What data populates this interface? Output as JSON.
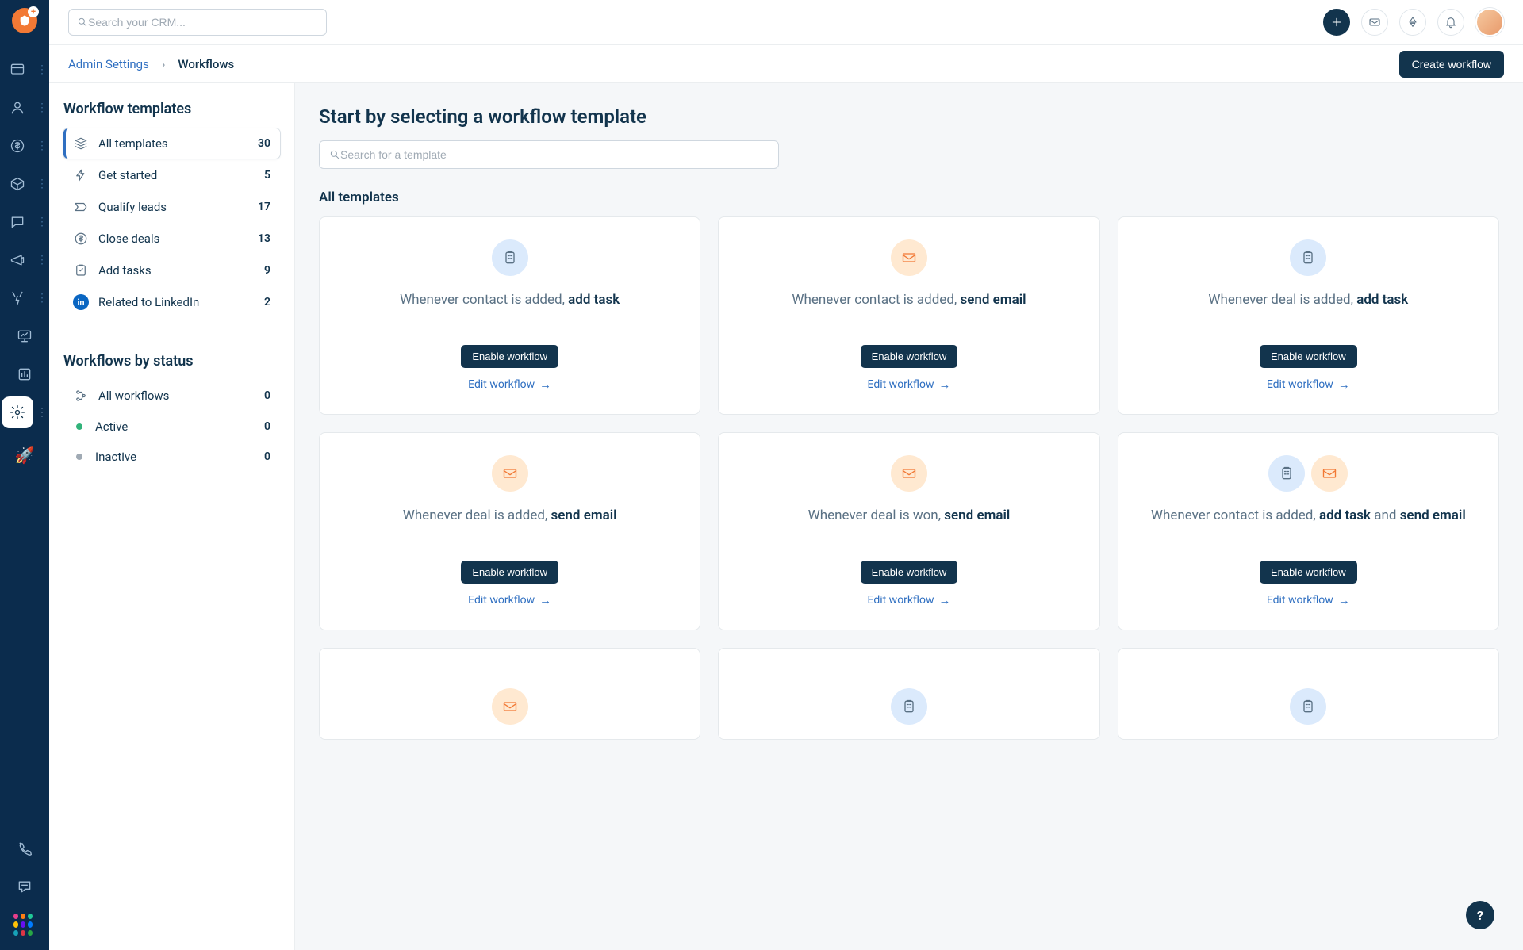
{
  "search_placeholder": "Search your CRM...",
  "breadcrumb": {
    "parent": "Admin Settings",
    "current": "Workflows"
  },
  "create_button": "Create workflow",
  "sidebar": {
    "templates_header": "Workflow templates",
    "status_header": "Workflows by status",
    "templates": [
      {
        "id": "all",
        "label": "All templates",
        "count": 30,
        "active": true
      },
      {
        "id": "get-started",
        "label": "Get started",
        "count": 5
      },
      {
        "id": "qualify-leads",
        "label": "Qualify leads",
        "count": 17
      },
      {
        "id": "close-deals",
        "label": "Close deals",
        "count": 13
      },
      {
        "id": "add-tasks",
        "label": "Add tasks",
        "count": 9
      },
      {
        "id": "linkedin",
        "label": "Related to LinkedIn",
        "count": 2
      }
    ],
    "status": [
      {
        "id": "all-wf",
        "label": "All workflows",
        "count": 0
      },
      {
        "id": "active",
        "label": "Active",
        "count": 0,
        "dot": "green"
      },
      {
        "id": "inactive",
        "label": "Inactive",
        "count": 0,
        "dot": "gray"
      }
    ]
  },
  "panel": {
    "heading": "Start by selecting a workflow template",
    "search_placeholder": "Search for a template",
    "section_title": "All templates",
    "enable_label": "Enable workflow",
    "edit_label": "Edit workflow",
    "cards": [
      {
        "icons": [
          "task"
        ],
        "prefix": "Whenever contact is added, ",
        "bold": "add task",
        "suffix": ""
      },
      {
        "icons": [
          "email"
        ],
        "prefix": "Whenever contact is added, ",
        "bold": "send email",
        "suffix": ""
      },
      {
        "icons": [
          "task"
        ],
        "prefix": "Whenever deal is added, ",
        "bold": "add task",
        "suffix": ""
      },
      {
        "icons": [
          "email"
        ],
        "prefix": "Whenever deal is added, ",
        "bold": "send email",
        "suffix": ""
      },
      {
        "icons": [
          "email"
        ],
        "prefix": "Whenever deal is won, ",
        "bold": "send email",
        "suffix": ""
      },
      {
        "icons": [
          "task",
          "email"
        ],
        "prefix": "Whenever contact is added, ",
        "bold": "add task",
        "mid": " and ",
        "bold2": "send email"
      }
    ],
    "placeholder_row": [
      {
        "icons": [
          "email"
        ]
      },
      {
        "icons": [
          "task"
        ]
      },
      {
        "icons": [
          "task"
        ]
      }
    ]
  }
}
